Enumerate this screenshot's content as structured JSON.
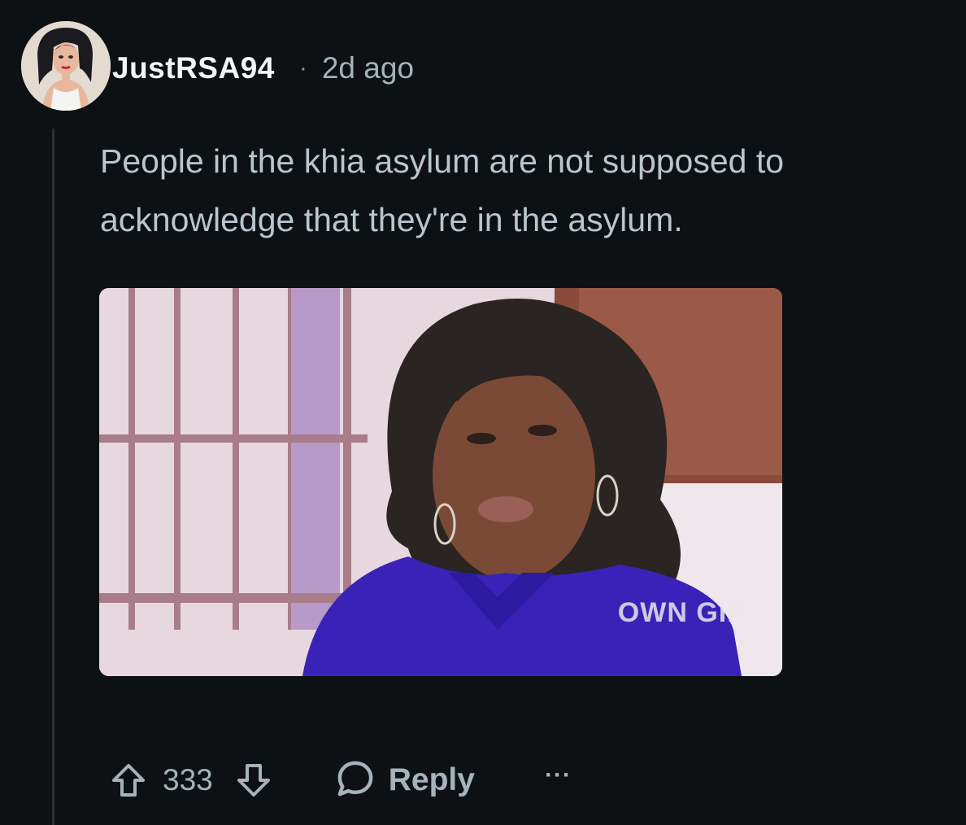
{
  "comment": {
    "username": "JustRSA94",
    "separator": "·",
    "timestamp": "2d ago",
    "body": "People in the khia asylum are not supposed to acknowledge that they're in the asylum.",
    "gif_watermark": "OWN GIF"
  },
  "actions": {
    "upvote_icon": "arrow-up-icon",
    "score": "333",
    "downvote_icon": "arrow-down-icon",
    "reply_icon": "speech-bubble-icon",
    "reply_label": "Reply",
    "more_label": "···"
  },
  "colors": {
    "background": "#0e1113",
    "text_primary": "#f2f4f5",
    "text_secondary": "#a5b3ba"
  }
}
